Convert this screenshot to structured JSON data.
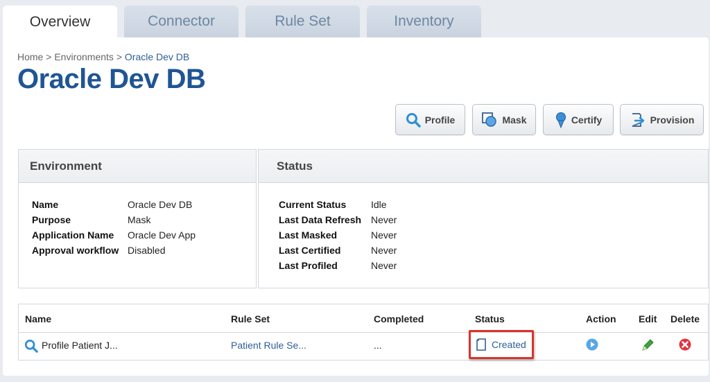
{
  "tabs": [
    {
      "label": "Overview",
      "active": true
    },
    {
      "label": "Connector",
      "active": false
    },
    {
      "label": "Rule Set",
      "active": false
    },
    {
      "label": "Inventory",
      "active": false
    }
  ],
  "breadcrumb": {
    "home": "Home",
    "sep1": ">",
    "environments": "Environments",
    "sep2": ">",
    "current": "Oracle Dev DB"
  },
  "page_title": "Oracle Dev DB",
  "actions": {
    "profile": "Profile",
    "mask": "Mask",
    "certify": "Certify",
    "provision": "Provision"
  },
  "environment": {
    "heading": "Environment",
    "fields": [
      {
        "label": "Name",
        "value": "Oracle Dev DB"
      },
      {
        "label": "Purpose",
        "value": "Mask"
      },
      {
        "label": "Application Name",
        "value": "Oracle Dev App"
      },
      {
        "label": "Approval workflow",
        "value": "Disabled"
      }
    ]
  },
  "status_box": {
    "heading": "Status",
    "fields": [
      {
        "label": "Current Status",
        "value": "Idle"
      },
      {
        "label": "Last Data Refresh",
        "value": "Never"
      },
      {
        "label": "Last Masked",
        "value": "Never"
      },
      {
        "label": "Last Certified",
        "value": "Never"
      },
      {
        "label": "Last Profiled",
        "value": "Never"
      }
    ]
  },
  "jobs_table": {
    "columns": {
      "name": "Name",
      "rule_set": "Rule Set",
      "completed": "Completed",
      "status": "Status",
      "action": "Action",
      "edit": "Edit",
      "delete": "Delete"
    },
    "rows": [
      {
        "name": "Profile Patient J...",
        "rule_set": "Patient Rule Se...",
        "completed": "...",
        "status": "Created"
      }
    ]
  },
  "colors": {
    "title": "#1f5594",
    "link": "#2d5e96",
    "highlight": "#d9342a",
    "run": "#5aa6e8",
    "edit": "#3fa43a",
    "delete": "#e0353f"
  }
}
